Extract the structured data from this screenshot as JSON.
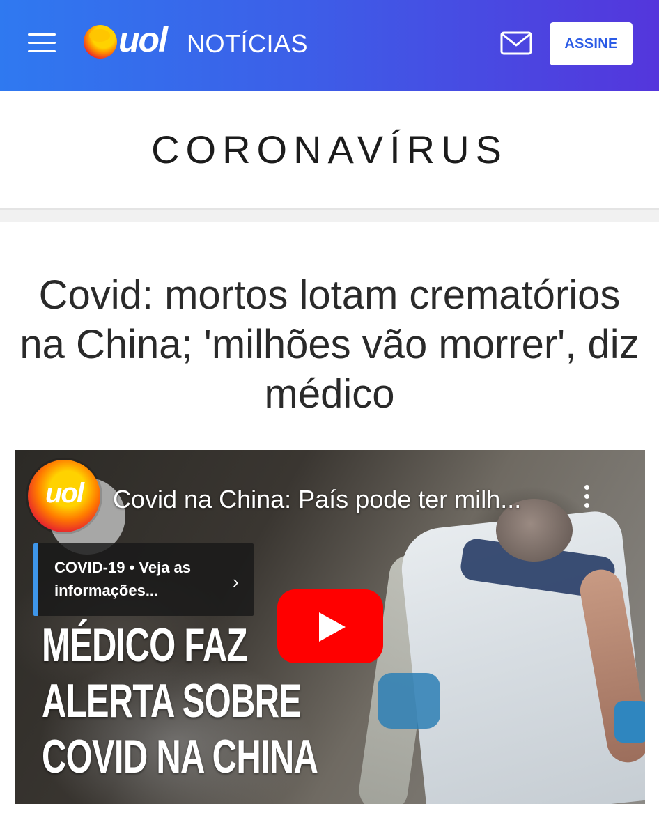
{
  "header": {
    "logo_text": "uol",
    "section_name": "NOTÍCIAS",
    "subscribe_label": "ASSINE",
    "colors": {
      "gradient_start": "#2f79f0",
      "gradient_end": "#5436dc",
      "subscribe_text": "#2b5be6"
    }
  },
  "section": {
    "title": "CORONAVÍRUS"
  },
  "article": {
    "headline": "Covid: mortos lotam crematórios na China; 'milhões vão morrer', diz médico"
  },
  "video": {
    "channel_logo_text": "uol",
    "title": "Covid na China: País pode ter milh...",
    "info_panel_text": "COVID-19 • Veja as informações...",
    "overlay_headline_lines": [
      "MÉDICO FAZ",
      "ALERTA SOBRE",
      "COVID NA CHINA"
    ],
    "colors": {
      "play_button": "#ff0000",
      "info_accent": "#3e96ea"
    }
  }
}
